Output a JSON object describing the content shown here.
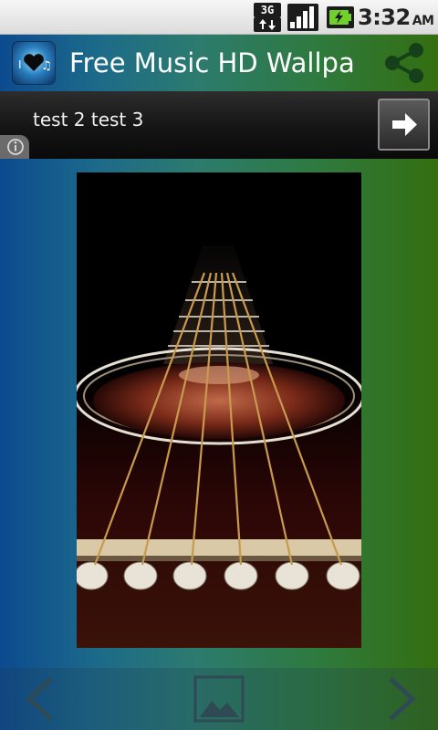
{
  "status_bar": {
    "network": "3G",
    "time": "3:32",
    "ampm": "AM",
    "icons": [
      "network-3g-icon",
      "signal-icon",
      "battery-charging-icon"
    ]
  },
  "app_bar": {
    "title": "Free Music HD Wallpa",
    "logo_icon": "music-heart-logo-icon",
    "share_icon": "share-icon"
  },
  "ad": {
    "text": "test 2 test 3",
    "go_icon": "arrow-right-icon",
    "info_icon": "info-icon"
  },
  "content": {
    "image_icon": "guitar-wallpaper-image"
  },
  "bottom_nav": {
    "prev_icon": "chevron-left-icon",
    "set_icon": "image-icon",
    "next_icon": "chevron-right-icon"
  },
  "colors": {
    "gradient_left": "#0c4a8f",
    "gradient_right": "#346e10"
  }
}
